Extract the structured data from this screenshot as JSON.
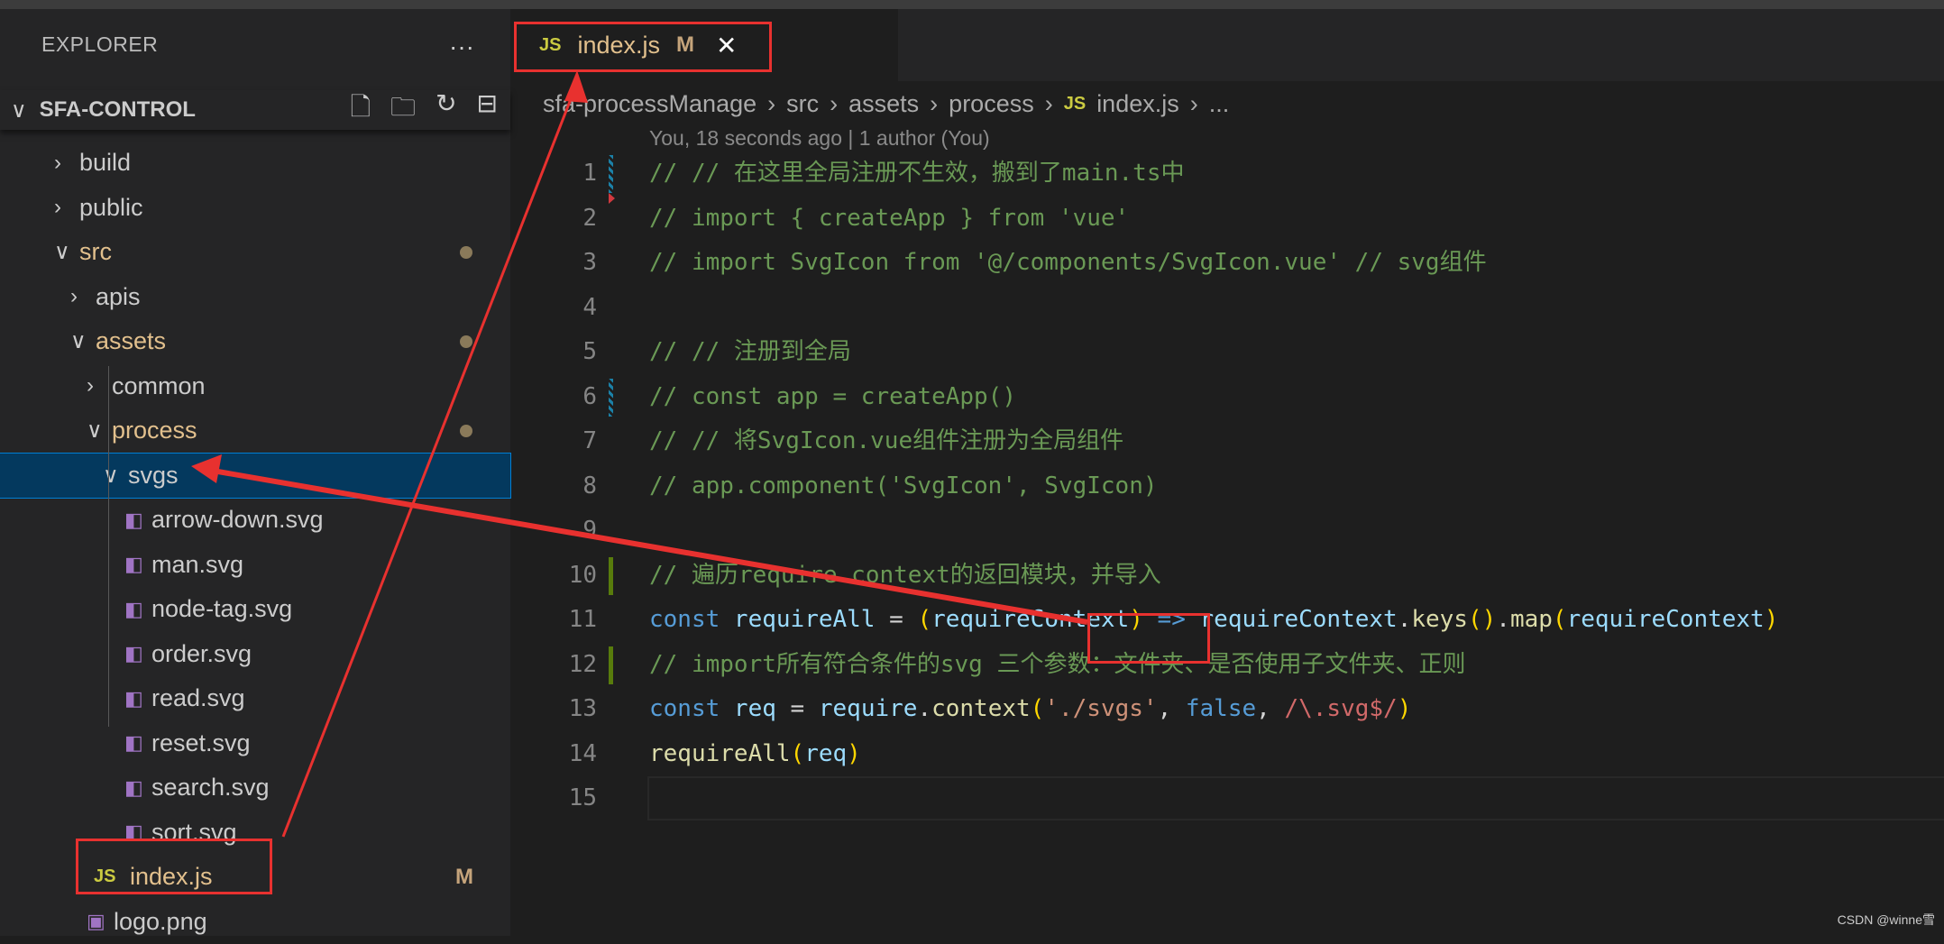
{
  "explorer": {
    "title": "EXPLORER",
    "more": "···",
    "project": "SFA-CONTROL",
    "actions": [
      {
        "icon": "new-file-icon",
        "glyph": "🗋"
      },
      {
        "icon": "new-folder-icon",
        "glyph": "🗀"
      },
      {
        "icon": "refresh-icon",
        "glyph": "↻"
      },
      {
        "icon": "collapse-all-icon",
        "glyph": "⊟"
      }
    ],
    "tree": [
      {
        "label": "build",
        "indent": 0,
        "type": "folder",
        "open": false
      },
      {
        "label": "public",
        "indent": 0,
        "type": "folder",
        "open": false
      },
      {
        "label": "src",
        "indent": 0,
        "type": "folder",
        "open": true,
        "modified": true
      },
      {
        "label": "apis",
        "indent": 1,
        "type": "folder",
        "open": false
      },
      {
        "label": "assets",
        "indent": 1,
        "type": "folder",
        "open": true,
        "modified": true
      },
      {
        "label": "common",
        "indent": 2,
        "type": "folder",
        "open": false
      },
      {
        "label": "process",
        "indent": 2,
        "type": "folder",
        "open": true,
        "modified": true
      },
      {
        "label": "svgs",
        "indent": 3,
        "type": "folder",
        "open": true,
        "selected": true
      },
      {
        "label": "arrow-down.svg",
        "indent": 4,
        "type": "svg"
      },
      {
        "label": "man.svg",
        "indent": 4,
        "type": "svg"
      },
      {
        "label": "node-tag.svg",
        "indent": 4,
        "type": "svg"
      },
      {
        "label": "order.svg",
        "indent": 4,
        "type": "svg"
      },
      {
        "label": "read.svg",
        "indent": 4,
        "type": "svg"
      },
      {
        "label": "reset.svg",
        "indent": 4,
        "type": "svg"
      },
      {
        "label": "search.svg",
        "indent": 4,
        "type": "svg"
      },
      {
        "label": "sort.svg",
        "indent": 4,
        "type": "svg"
      },
      {
        "label": "index.js",
        "indent": 3,
        "type": "js",
        "badge": "M"
      },
      {
        "label": "logo.png",
        "indent": 2,
        "type": "image"
      }
    ]
  },
  "tab": {
    "icon": "JS",
    "name": "index.js",
    "badge": "M",
    "close": "✕"
  },
  "breadcrumb": [
    "sfa-processManage",
    "src",
    "assets",
    "process",
    "index.js",
    "..."
  ],
  "blame": "You, 18 seconds ago | 1 author (You)",
  "code": [
    {
      "n": "1",
      "gutter": "modified",
      "tokens": [
        [
          "c",
          "// // 在这里全局注册不生效，搬到了main.ts中"
        ]
      ]
    },
    {
      "n": "2",
      "gutter": "deleted",
      "tokens": [
        [
          "c",
          "// import { createApp } from 'vue'"
        ]
      ]
    },
    {
      "n": "3",
      "tokens": [
        [
          "c",
          "// import SvgIcon from '@/components/SvgIcon.vue' // svg组件"
        ]
      ]
    },
    {
      "n": "4",
      "tokens": []
    },
    {
      "n": "5",
      "tokens": [
        [
          "c",
          "// // 注册到全局"
        ]
      ]
    },
    {
      "n": "6",
      "gutter": "modified",
      "tokens": [
        [
          "c",
          "// const app = createApp()"
        ]
      ]
    },
    {
      "n": "7",
      "tokens": [
        [
          "c",
          "// // 将SvgIcon.vue组件注册为全局组件"
        ]
      ]
    },
    {
      "n": "8",
      "tokens": [
        [
          "c",
          "// app.component('SvgIcon', SvgIcon)"
        ]
      ]
    },
    {
      "n": "9",
      "tokens": []
    },
    {
      "n": "10",
      "gutter": "added",
      "tokens": [
        [
          "c",
          "// 遍历require.context的返回模块，并导入"
        ]
      ]
    },
    {
      "n": "11",
      "tokens": [
        [
          "k",
          "const "
        ],
        [
          "v",
          "requireAll"
        ],
        [
          "o",
          " = "
        ],
        [
          "p",
          "("
        ],
        [
          "v",
          "requireContext"
        ],
        [
          "p",
          ")"
        ],
        [
          "k",
          " => "
        ],
        [
          "v",
          "requireContext"
        ],
        [
          "o",
          "."
        ],
        [
          "f",
          "keys"
        ],
        [
          "p",
          "()"
        ],
        [
          "o",
          "."
        ],
        [
          "f",
          "map"
        ],
        [
          "p",
          "("
        ],
        [
          "v",
          "requireContext"
        ],
        [
          "p",
          ")"
        ]
      ]
    },
    {
      "n": "12",
      "gutter": "added",
      "tokens": [
        [
          "c",
          "// import所有符合条件的svg 三个参数：文件夹、是否使用子文件夹、正则"
        ]
      ]
    },
    {
      "n": "13",
      "tokens": [
        [
          "k",
          "const "
        ],
        [
          "v",
          "req"
        ],
        [
          "o",
          " = "
        ],
        [
          "v",
          "require"
        ],
        [
          "o",
          "."
        ],
        [
          "f",
          "context"
        ],
        [
          "p",
          "("
        ],
        [
          "s",
          "'./svgs'"
        ],
        [
          "o",
          ", "
        ],
        [
          "k",
          "false"
        ],
        [
          "o",
          ", "
        ],
        [
          "r",
          "/\\.svg$/"
        ],
        [
          "p",
          ")"
        ]
      ]
    },
    {
      "n": "14",
      "tokens": [
        [
          "f",
          "requireAll"
        ],
        [
          "p",
          "("
        ],
        [
          "v",
          "req"
        ],
        [
          "p",
          ")"
        ]
      ]
    },
    {
      "n": "15",
      "tokens": []
    }
  ],
  "watermark": "CSDN @winne雪",
  "colors": {
    "annotation": "#e8312f",
    "selection": "#04395e",
    "accent": "#007fd4"
  }
}
